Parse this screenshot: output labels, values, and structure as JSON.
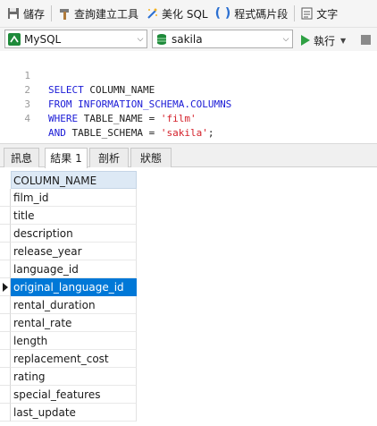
{
  "toolbar": {
    "save": "儲存",
    "query_builder": "查詢建立工具",
    "beautify_sql": "美化 SQL",
    "code_snippet": "程式碼片段",
    "text": "文字"
  },
  "connection": {
    "engine": "MySQL",
    "database": "sakila",
    "run_label": "執行"
  },
  "editor": {
    "lines": [
      {
        "num": "1"
      },
      {
        "num": "2"
      },
      {
        "num": "3"
      },
      {
        "num": "4"
      }
    ],
    "tokens": {
      "select": "SELECT",
      "column_name": " COLUMN_NAME",
      "from": "FROM",
      "schema_table": " INFORMATION_SCHEMA.COLUMNS",
      "where": "WHERE",
      "table_name": " TABLE_NAME = ",
      "film": "'film'",
      "and": "AND",
      "table_schema": " TABLE_SCHEMA = ",
      "sakila": "'sakila'",
      "semicolon": ";"
    }
  },
  "tabs": [
    "訊息",
    "結果 1",
    "剖析",
    "狀態"
  ],
  "active_tab": "結果 1",
  "grid": {
    "column_header": "COLUMN_NAME",
    "rows": [
      "film_id",
      "title",
      "description",
      "release_year",
      "language_id",
      "original_language_id",
      "rental_duration",
      "rental_rate",
      "length",
      "replacement_cost",
      "rating",
      "special_features",
      "last_update"
    ],
    "selected_row": "original_language_id"
  },
  "colors": {
    "keyword": "#1a1ad6",
    "string": "#d4202a",
    "selection": "#0078d7",
    "run_green": "#2ea043",
    "db_green": "#1e8a3a"
  }
}
